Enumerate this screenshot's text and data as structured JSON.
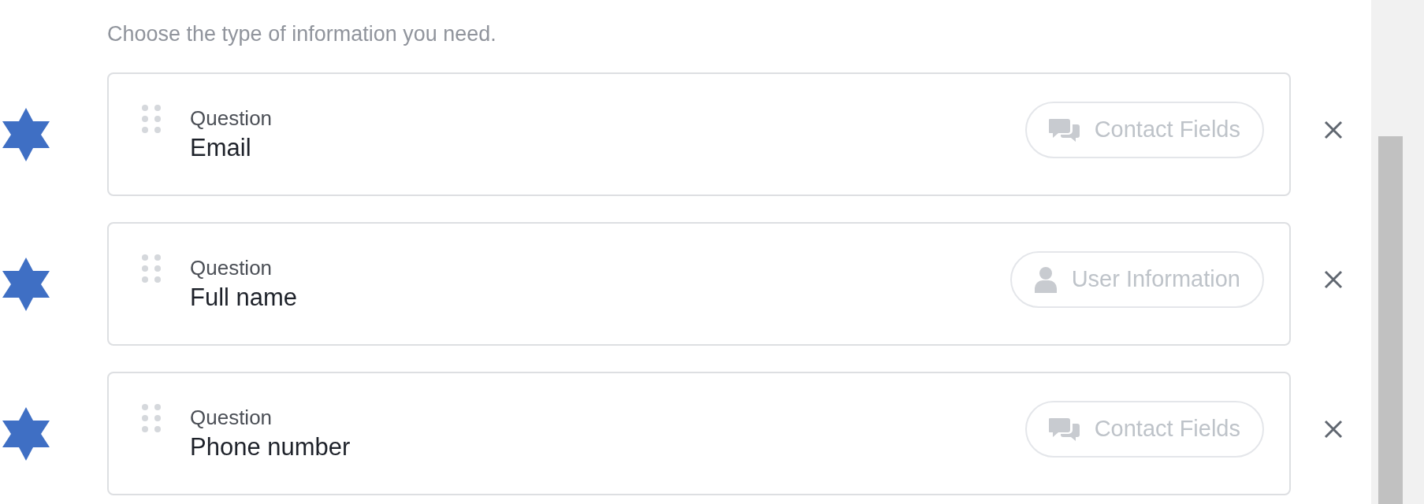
{
  "instruction": "Choose the type of information you need.",
  "questions": [
    {
      "label": "Question",
      "value": "Email",
      "tag": {
        "kind": "contact",
        "text": "Contact Fields"
      }
    },
    {
      "label": "Question",
      "value": "Full name",
      "tag": {
        "kind": "user",
        "text": "User Information"
      }
    },
    {
      "label": "Question",
      "value": "Phone number",
      "tag": {
        "kind": "contact",
        "text": "Contact Fields"
      }
    }
  ]
}
